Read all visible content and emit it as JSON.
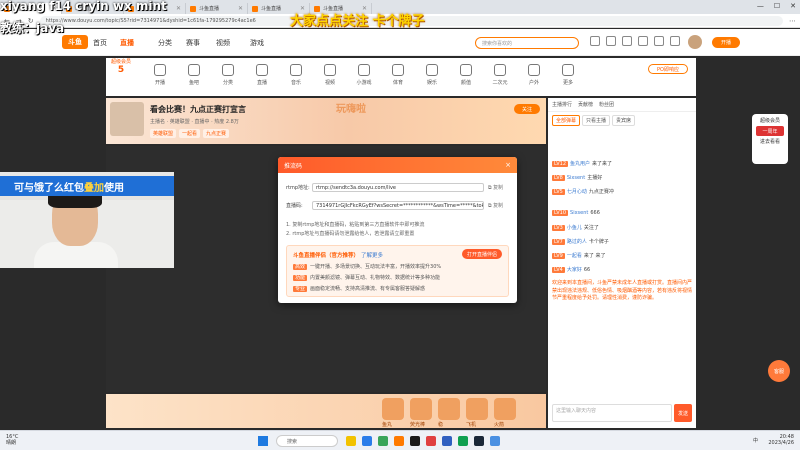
{
  "overlay": {
    "top_left_line1": "xiyang f14 cryin wx mint",
    "top_left_line2": "教练：java",
    "center_caption": "大家点点关注 卡个牌子",
    "cam_banner_prefix": "可与饿了么红包",
    "cam_banner_highlight": "叠加",
    "cam_banner_suffix": "使用"
  },
  "browser": {
    "tabs": [
      {
        "label": "斗鱼直播"
      },
      {
        "label": "斗鱼直播"
      },
      {
        "label": "斗鱼直播首页"
      },
      {
        "label": "斗鱼直播"
      },
      {
        "label": "斗鱼直播"
      },
      {
        "label": "斗鱼直播"
      }
    ],
    "url": "https://www.douyu.com/topic/S5?rid=7314971&dyshid=1c61fa-179295279c4ac1e6"
  },
  "site": {
    "logo": "斗鱼",
    "nav": [
      "首页",
      "直播",
      "分类",
      "赛事",
      "视频",
      "游戏"
    ],
    "nav_selected": 1,
    "search_placeholder": "搜索你喜欢的",
    "open_label": "开播"
  },
  "categories": {
    "level_label": "超级会员",
    "level_num": "5",
    "items": [
      "开播",
      "鱼吧",
      "分类",
      "直播",
      "音乐",
      "视频",
      "小游戏",
      "体育",
      "娱乐",
      "颜值",
      "二次元",
      "户外",
      "更多"
    ],
    "po_label": "PO即响应"
  },
  "room": {
    "title": "看会比赛！九点正赛打宣言",
    "meta": "主播名 · 英雄联盟 · 直播中 · 热度 2.8万",
    "tags": [
      "英雄联盟",
      "一起看",
      "九点正赛"
    ],
    "follow": "关注",
    "banner_art": "玩嗨啦"
  },
  "modal": {
    "title": "推流码",
    "addr_label": "rtmp地址:",
    "addr_value": "rtmp://sendtc3a.douyu.com/live",
    "code_label": "直播码:",
    "code_value": "7314971rGJIcFkcRGyEf?wsSecret=************&wsTime=*****&token=web&stamp_id=",
    "copy": "复制",
    "note1": "1. 复制rtmp地址和直播码，粘贴到第三方直播软件中即可推流",
    "note2": "2. rtmp地址与直播码请勿泄露给他人，若泄露请立即重置",
    "promo_title": "斗鱼直播伴侣（官方推荐）",
    "promo_link": "了解更多",
    "promo_btn": "打开直播伴侣",
    "promo_lines": [
      {
        "tag": "高效",
        "text": "一键开播、多场景切换、互动玩法丰富，开播效率提升30%"
      },
      {
        "tag": "功能",
        "text": "内置美颜滤镜、弹幕互动、礼物特效、数据统计等多种功能"
      },
      {
        "tag": "专业",
        "text": "画面稳定流畅、支持高清推流、有专属客服答疑解惑"
      }
    ]
  },
  "gifts": {
    "items": [
      "鱼丸",
      "荧光棒",
      "稳",
      "飞机",
      "火箭"
    ]
  },
  "chat": {
    "top": [
      "主播排行",
      "贡献榜",
      "粉丝团"
    ],
    "tabs": [
      "全部弹幕",
      "只看主播",
      "贵宾席"
    ],
    "lines": [
      {
        "badge": "LV12",
        "nick": "鱼丸用户",
        "text": "来了来了"
      },
      {
        "badge": "LV8",
        "nick": "Sixsent",
        "text": "主播好"
      },
      {
        "badge": "LV5",
        "nick": "七月心动",
        "text": "九点正赛冲"
      },
      {
        "badge": "LV10",
        "nick": "Sixsent",
        "text": "666"
      },
      {
        "badge": "LV3",
        "nick": "小鱼儿",
        "text": "关注了"
      },
      {
        "badge": "LV7",
        "nick": "路过的人",
        "text": "卡个牌子"
      },
      {
        "badge": "LV9",
        "nick": "一起看",
        "text": "来了 来了"
      },
      {
        "badge": "LV4",
        "nick": "大家好",
        "text": "66"
      }
    ],
    "notice": "欢迎来到本直播间，斗鱼严禁未成年人直播或打赏。直播间内严禁出现违法违规、低俗色情、吸烟酗酒等内容，若有违反将视情节严重程度给予处罚。请理性消费，谨防诈骗。",
    "input_placeholder": "这里输入聊天内容",
    "send": "发送"
  },
  "sidebox": {
    "title": "超级会员",
    "badge": "一周年",
    "sub": "进去看看"
  },
  "float_btn": "客服",
  "taskbar": {
    "weather_temp": "16°C",
    "weather_desc": "晴朗",
    "search": "搜索",
    "time": "20:48",
    "date": "2023/4/26",
    "tray": "中"
  }
}
